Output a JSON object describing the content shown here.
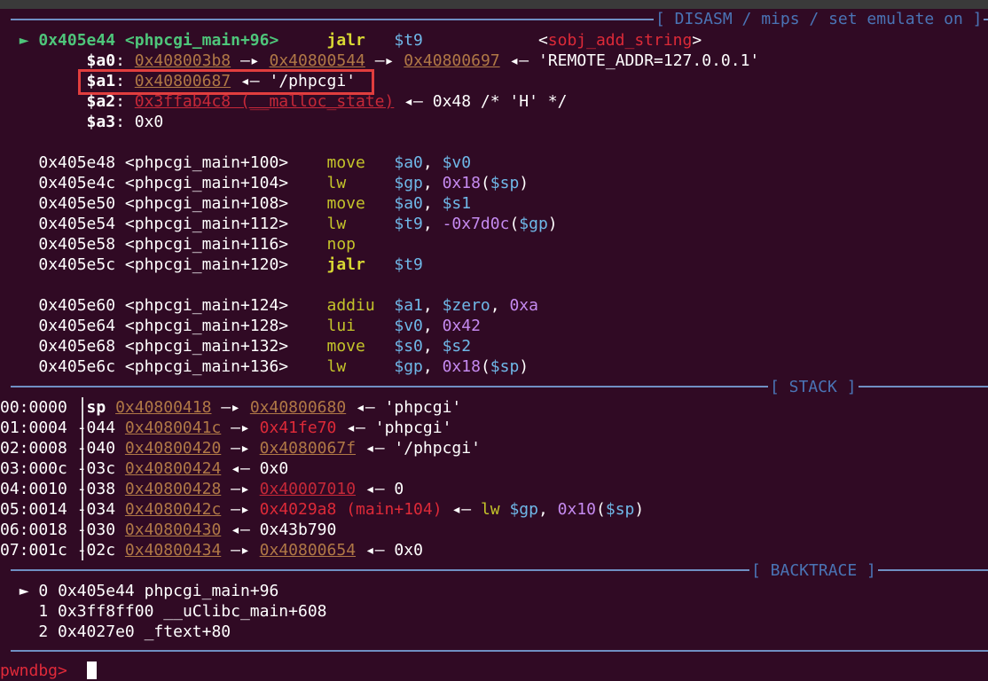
{
  "disasm": {
    "header": "[ DISASM / mips / set emulate on ]",
    "current": {
      "arrow": "►",
      "addr": "0x405e44",
      "sym": "<phpcgi_main+96>",
      "mnem": "jalr",
      "op": "$t9",
      "target_open": "<",
      "target": "sobj_add_string",
      "target_close": ">"
    },
    "regs": [
      {
        "name": "$a0",
        "colon": ":",
        "v1": "0x408003b8",
        "arr1": "—▸",
        "v2": "0x40800544",
        "arr2": "—▸",
        "v3": "0x40800697",
        "arr3": "◂—",
        "tail": "'REMOTE_ADDR=127.0.0.1'"
      },
      {
        "name": "$a1",
        "colon": ":",
        "v1": "0x40800687",
        "arr1": "◂—",
        "tail": "'/phpcgi'"
      },
      {
        "name": "$a2",
        "colon": ":",
        "v1": "0x3ffab4c8 (__malloc_state)",
        "arr1": "◂—",
        "tail": "0x48 /* 'H' */"
      },
      {
        "name": "$a3",
        "colon": ":",
        "tail": "0x0"
      }
    ],
    "block1": [
      {
        "addr": "0x405e48",
        "sym": "<phpcgi_main+100>",
        "mnem": "move",
        "a": "$a0",
        "s1": ", ",
        "b": "$v0"
      },
      {
        "addr": "0x405e4c",
        "sym": "<phpcgi_main+104>",
        "mnem": "lw",
        "a": "$gp",
        "s1": ", ",
        "n": "0x18",
        "lp": "(",
        "b": "$sp",
        "rp": ")"
      },
      {
        "addr": "0x405e50",
        "sym": "<phpcgi_main+108>",
        "mnem": "move",
        "a": "$a0",
        "s1": ", ",
        "b": "$s1"
      },
      {
        "addr": "0x405e54",
        "sym": "<phpcgi_main+112>",
        "mnem": "lw",
        "a": "$t9",
        "s1": ", ",
        "n": "-0x7d0c",
        "lp": "(",
        "b": "$gp",
        "rp": ")"
      },
      {
        "addr": "0x405e58",
        "sym": "<phpcgi_main+116>",
        "mnem": "nop"
      },
      {
        "addr": "0x405e5c",
        "sym": "<phpcgi_main+120>",
        "mnem": "jalr",
        "a": "$t9"
      }
    ],
    "block2": [
      {
        "addr": "0x405e60",
        "sym": "<phpcgi_main+124>",
        "mnem": "addiu",
        "a": "$a1",
        "s1": ", ",
        "b": "$zero",
        "s2": ", ",
        "n": "0xa"
      },
      {
        "addr": "0x405e64",
        "sym": "<phpcgi_main+128>",
        "mnem": "lui",
        "a": "$v0",
        "s1": ", ",
        "n": "0x42"
      },
      {
        "addr": "0x405e68",
        "sym": "<phpcgi_main+132>",
        "mnem": "move",
        "a": "$s0",
        "s1": ", ",
        "b": "$s2"
      },
      {
        "addr": "0x405e6c",
        "sym": "<phpcgi_main+136>",
        "mnem": "lw",
        "a": "$gp",
        "s1": ", ",
        "n": "0x18",
        "lp": "(",
        "b": "$sp",
        "rp": ")"
      }
    ]
  },
  "stack": {
    "header": "[ STACK ]",
    "rows": [
      {
        "idx": "00:0000",
        "off": "sp",
        "a": "0x40800418",
        "arr": "—▸",
        "b": "0x40800680",
        "arr2": "◂—",
        "val": "'phpcgi'"
      },
      {
        "idx": "01:0004",
        "off": "-044",
        "a": "0x4080041c",
        "arr": "—▸",
        "b": "0x41fe70",
        "arr2": "◂—",
        "val": "'phpcgi'"
      },
      {
        "idx": "02:0008",
        "off": "-040",
        "a": "0x40800420",
        "arr": "—▸",
        "b": "0x4080067f",
        "arr2": "◂—",
        "val": "'/phpcgi'"
      },
      {
        "idx": "03:000c",
        "off": "-03c",
        "a": "0x40800424",
        "arr2": "◂—",
        "val": "0x0"
      },
      {
        "idx": "04:0010",
        "off": "-038",
        "a": "0x40800428",
        "arr": "—▸",
        "b": "0x40007010",
        "arr2": "◂—",
        "val": "0"
      },
      {
        "idx": "05:0014",
        "off": "-034",
        "a": "0x4080042c",
        "arr": "—▸",
        "b": "0x4029a8 (main+104)",
        "arr2": "◂—",
        "mn": "lw",
        "r1": "$gp",
        "c1": ", ",
        "n": "0x10",
        "lp": "(",
        "r2": "$sp",
        "rp": ")"
      },
      {
        "idx": "06:0018",
        "off": "-030",
        "a": "0x40800430",
        "arr2": "◂—",
        "val": "0x43b790"
      },
      {
        "idx": "07:001c",
        "off": "-02c",
        "a": "0x40800434",
        "arr": "—▸",
        "b": "0x40800654",
        "arr2": "◂—",
        "val": "0x0"
      }
    ]
  },
  "backtrace": {
    "header": "[ BACKTRACE ]",
    "frames": [
      {
        "mark": "►",
        "n": "0",
        "addr": "0x405e44",
        "sym": "phpcgi_main+96"
      },
      {
        "mark": "",
        "n": "1",
        "addr": "0x3ff8ff00",
        "sym": "__uClibc_main+608"
      },
      {
        "mark": "",
        "n": "2",
        "addr": "0x4027e0",
        "sym": "_ftext+80"
      }
    ]
  },
  "prompt": "pwndbg>"
}
